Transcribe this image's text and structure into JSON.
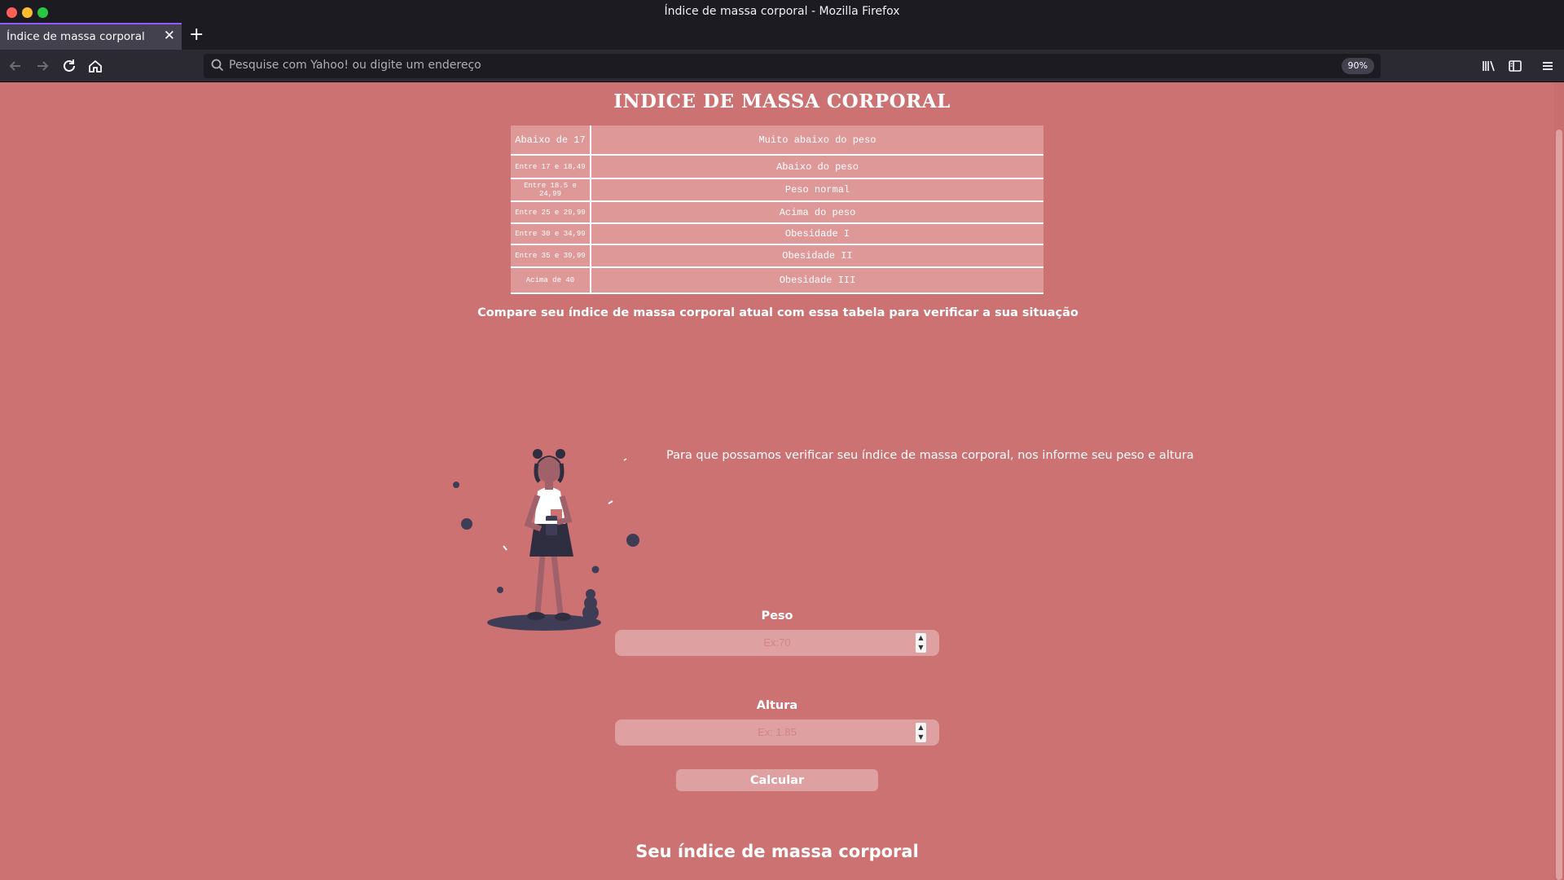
{
  "window": {
    "title": "Índice de massa corporal - Mozilla Firefox"
  },
  "tab": {
    "label": "Índice de massa corporal",
    "close_glyph": "✕",
    "new_tab_glyph": "+"
  },
  "navbar": {
    "url_placeholder": "Pesquise com Yahoo! ou digite um endereço",
    "zoom": "90%"
  },
  "page": {
    "title": "INDICE DE MASSA CORPORAL",
    "table": [
      {
        "range": "Abaixo de 17",
        "status": "Muito abaixo do peso"
      },
      {
        "range": "Entre 17 e 18,49",
        "status": "Abaixo do peso"
      },
      {
        "range": "Entre 18.5 e 24,99",
        "status": "Peso normal"
      },
      {
        "range": "Entre 25 e 29,99",
        "status": "Acima do peso"
      },
      {
        "range": "Entre 30 e 34,99",
        "status": "Obesidade I"
      },
      {
        "range": "Entre 35 e 39,99",
        "status": "Obesidade II"
      },
      {
        "range": "Acima de 40",
        "status": "Obesidade III"
      }
    ],
    "compare_text": "Compare seu índice de massa corporal atual com essa tabela para verificar a sua situação",
    "info_text": "Para que possamos verificar seu índice de massa corporal, nos informe seu peso e altura",
    "peso_label": "Peso",
    "peso_placeholder": "Ex:70",
    "altura_label": "Altura",
    "altura_placeholder": "Ex: 1.85",
    "calc_label": "Calcular",
    "result_heading": "Seu índice de massa corporal"
  },
  "colors": {
    "page_bg": "#cd7272",
    "table_cell": "#de9898",
    "input_bg": "#dea0a0",
    "chrome_bg": "#1c1b22",
    "toolbar_bg": "#2b2a33"
  }
}
